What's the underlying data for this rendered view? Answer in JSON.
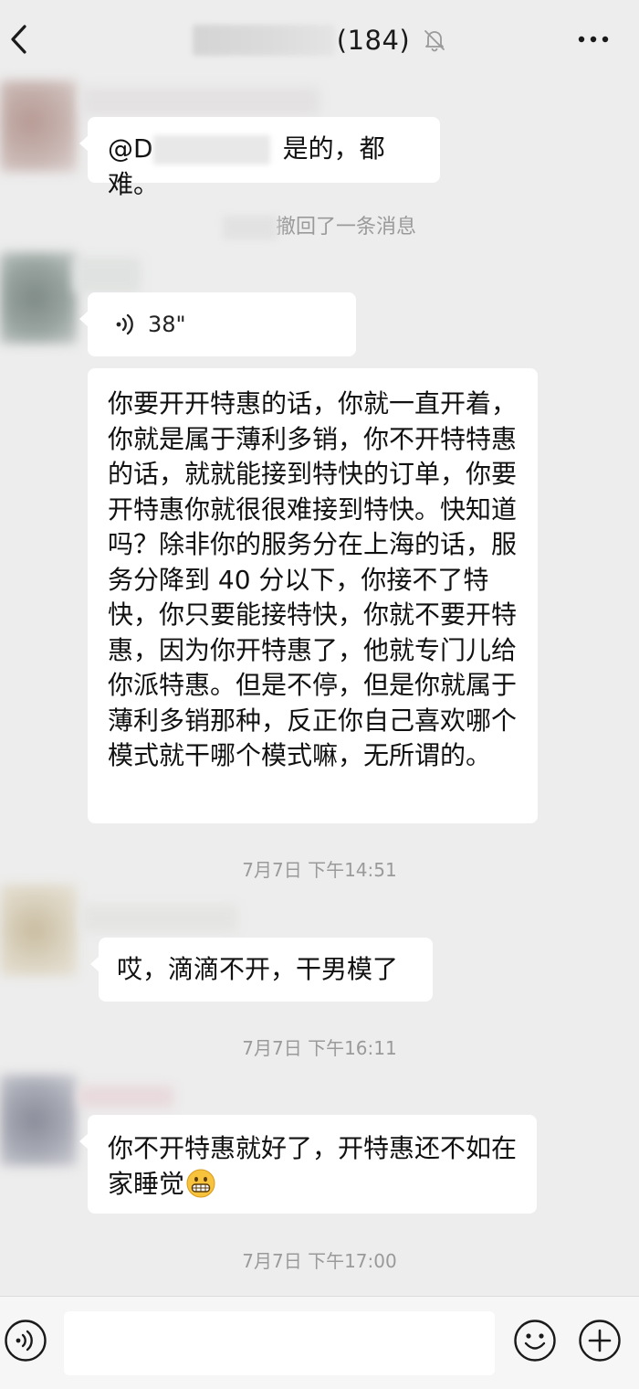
{
  "header": {
    "member_count": "(184)",
    "back_icon": "chevron-left-icon",
    "mute_icon": "bell-off-icon",
    "more_icon": "more-dots-icon"
  },
  "messages": [
    {
      "prefix": "@D",
      "text": "是的，都难。"
    },
    {
      "recall_text": "撤回了一条消息"
    },
    {
      "voice_duration": "38\""
    },
    {
      "text": "你要开开特惠的话，你就一直开着，你就是属于薄利多销，你不开特特惠的话，就就能接到特快的订单，你要开特惠你就很很难接到特快。快知道吗？除非你的服务分在上海的话，服务分降到 40 分以下，你接不了特快，你只要能接特快，你就不要开特惠，因为你开特惠了，他就专门儿给你派特惠。但是不停，但是你就属于薄利多销那种，反正你自己喜欢哪个模式就干哪个模式嘛，无所谓的。"
    },
    {
      "timestamp": "7月7日 下午14:51"
    },
    {
      "text": "哎，滴滴不开，干男模了"
    },
    {
      "timestamp": "7月7日 下午16:11"
    },
    {
      "text": "你不开特惠就好了，开特惠还不如在家睡觉",
      "emoji": "grinning-face-icon"
    },
    {
      "timestamp": "7月7日 下午17:00"
    }
  ],
  "input_bar": {
    "voice_icon": "voice-toggle-icon",
    "emoji_icon": "emoji-icon",
    "plus_icon": "plus-icon",
    "placeholder": ""
  }
}
